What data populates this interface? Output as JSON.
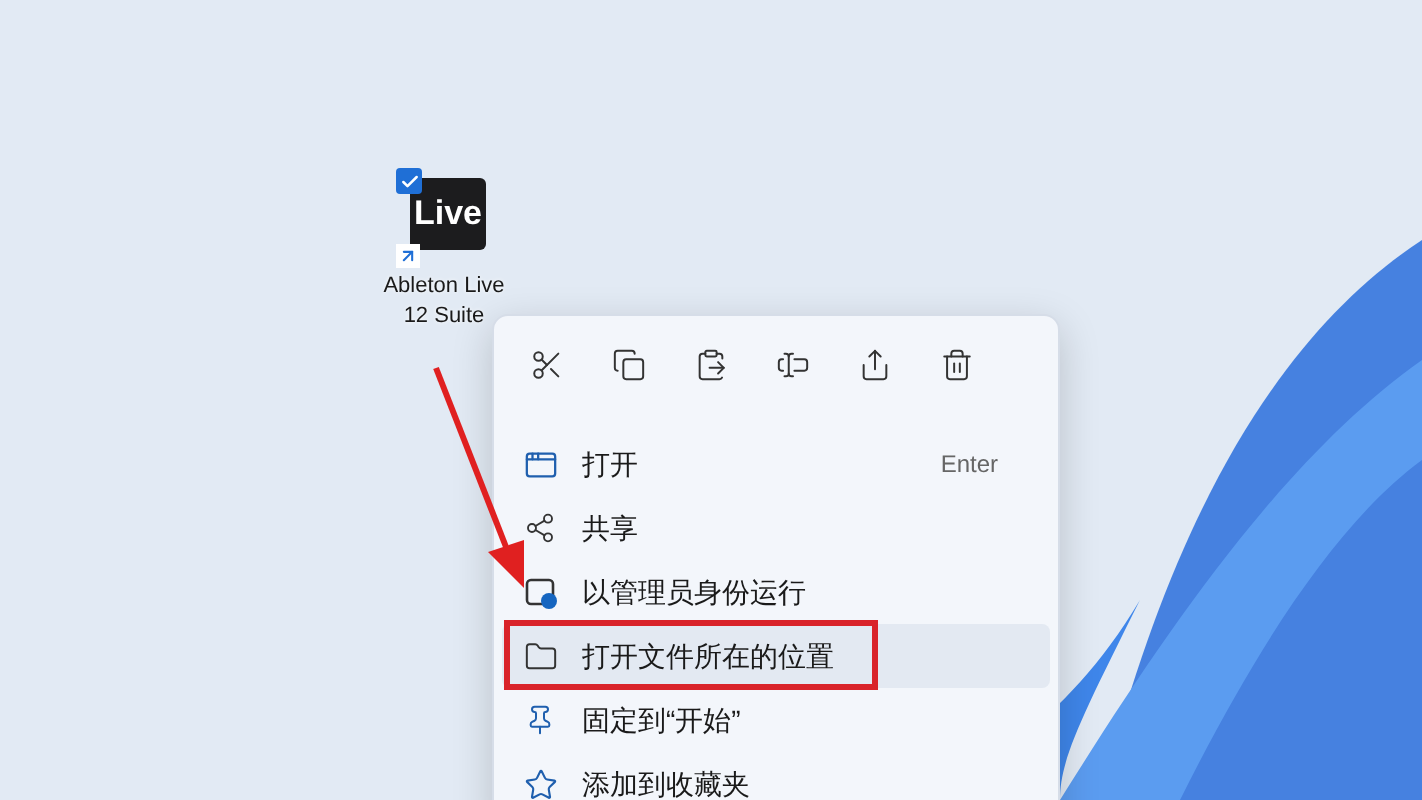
{
  "desktop_icon": {
    "badge": "Live",
    "label": "Ableton Live 12 Suite",
    "checked": true
  },
  "context_menu": {
    "toolbar": [
      {
        "kind": "cut"
      },
      {
        "kind": "copy"
      },
      {
        "kind": "paste"
      },
      {
        "kind": "rename"
      },
      {
        "kind": "share"
      },
      {
        "kind": "delete"
      }
    ],
    "items": [
      {
        "kind": "open",
        "label": "打开",
        "shortcut": "Enter",
        "selected": false,
        "outlined": false
      },
      {
        "kind": "share",
        "label": "共享",
        "selected": false,
        "outlined": false
      },
      {
        "kind": "admin",
        "label": "以管理员身份运行",
        "selected": false,
        "outlined": false
      },
      {
        "kind": "folder",
        "label": "打开文件所在的位置",
        "selected": true,
        "outlined": true
      },
      {
        "kind": "pin",
        "label": "固定到“开始”",
        "selected": false,
        "outlined": false
      },
      {
        "kind": "star",
        "label": "添加到收藏夹",
        "selected": false,
        "outlined": false
      }
    ]
  }
}
